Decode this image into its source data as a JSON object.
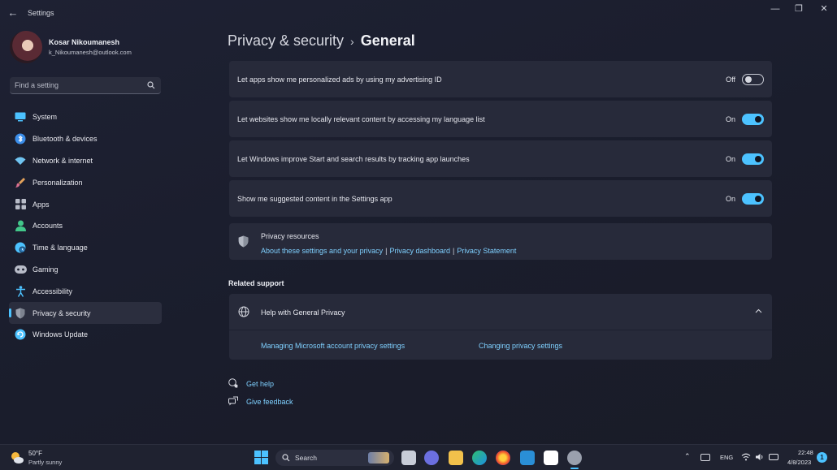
{
  "window": {
    "title": "Settings"
  },
  "profile": {
    "name": "Kosar Nikoumanesh",
    "email": "k_Nikoumanesh@outlook.com"
  },
  "search": {
    "placeholder": "Find a setting"
  },
  "nav": {
    "items": [
      {
        "label": "System",
        "icon": "monitor-icon",
        "color": "#4cc2ff"
      },
      {
        "label": "Bluetooth & devices",
        "icon": "bluetooth-icon",
        "color": "#3b8eea"
      },
      {
        "label": "Network & internet",
        "icon": "wifi-icon",
        "color": "#6fc3f0"
      },
      {
        "label": "Personalization",
        "icon": "paintbrush-icon",
        "color": "#e3a25b"
      },
      {
        "label": "Apps",
        "icon": "apps-grid-icon",
        "color": "#b8bcc8"
      },
      {
        "label": "Accounts",
        "icon": "person-icon",
        "color": "#42c78a"
      },
      {
        "label": "Time & language",
        "icon": "globe-clock-icon",
        "color": "#4cc2ff"
      },
      {
        "label": "Gaming",
        "icon": "gamepad-icon",
        "color": "#b8bcc8"
      },
      {
        "label": "Accessibility",
        "icon": "accessibility-icon",
        "color": "#4cc2ff"
      },
      {
        "label": "Privacy & security",
        "icon": "shield-icon",
        "color": "#9aa0ad"
      },
      {
        "label": "Windows Update",
        "icon": "refresh-icon",
        "color": "#4cc2ff"
      }
    ],
    "selected_index": 9
  },
  "header": {
    "parent": "Privacy & security",
    "chevron": "›",
    "current": "General"
  },
  "settings": [
    {
      "label": "Let apps show me personalized ads by using my advertising ID",
      "state": "Off",
      "on": false
    },
    {
      "label": "Let websites show me locally relevant content by accessing my language list",
      "state": "On",
      "on": true
    },
    {
      "label": "Let Windows improve Start and search results by tracking app launches",
      "state": "On",
      "on": true
    },
    {
      "label": "Show me suggested content in the Settings app",
      "state": "On",
      "on": true
    }
  ],
  "privacy_resources": {
    "title": "Privacy resources",
    "links": [
      "About these settings and your privacy",
      "Privacy dashboard",
      "Privacy Statement"
    ],
    "separator": "|"
  },
  "related_support": {
    "heading": "Related support",
    "help_title": "Help with General Privacy",
    "links": [
      "Managing Microsoft account privacy settings",
      "Changing privacy settings"
    ]
  },
  "footer_links": {
    "get_help": "Get help",
    "give_feedback": "Give feedback"
  },
  "taskbar": {
    "weather_temp": "50°F",
    "weather_desc": "Partly sunny",
    "search_label": "Search",
    "language": "ENG",
    "time": "22:48",
    "date": "4/8/2023",
    "notification_count": "1"
  },
  "colors": {
    "accent": "#4cc2ff",
    "link": "#7fd0ff",
    "card": "#272a3a"
  }
}
